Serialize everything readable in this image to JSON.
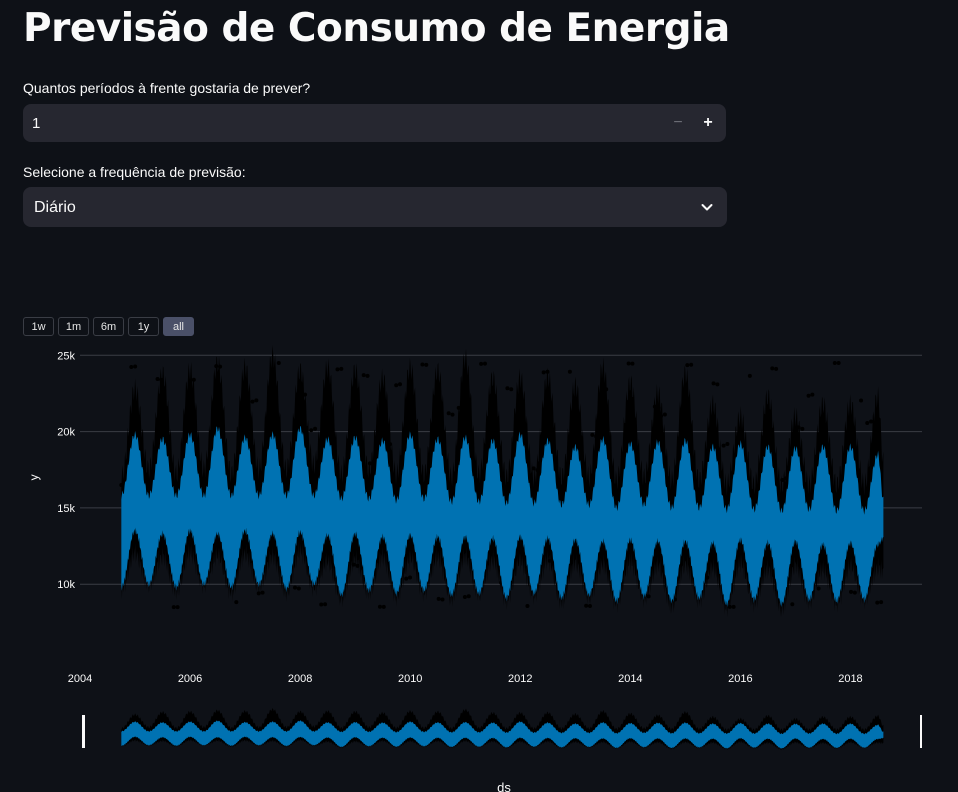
{
  "page_title": "Previsão de Consumo de Energia",
  "periods": {
    "label": "Quantos períodos à frente gostaria de prever?",
    "value": "1",
    "minus": "−",
    "plus": "+"
  },
  "frequency": {
    "label": "Selecione a frequência de previsão:",
    "value": "Diário"
  },
  "range_selector": {
    "buttons": [
      "1w",
      "1m",
      "6m",
      "1y",
      "all"
    ],
    "active": "all"
  },
  "colors": {
    "background": "#0e1117",
    "forecast": "#0072b2",
    "actual": "#000000",
    "grid": "#3a3d45"
  },
  "chart_data": {
    "type": "line",
    "xlabel": "ds",
    "ylabel": "y",
    "xlim": [
      2004,
      2019.3
    ],
    "ylim": [
      7000,
      26000
    ],
    "x_ticks": [
      "2004",
      "2006",
      "2008",
      "2010",
      "2012",
      "2014",
      "2016",
      "2018"
    ],
    "y_ticks": [
      {
        "value": 10000,
        "label": "10k"
      },
      {
        "value": 15000,
        "label": "15k"
      },
      {
        "value": 20000,
        "label": "20k"
      },
      {
        "value": 25000,
        "label": "25k"
      }
    ],
    "grid": true,
    "rangeslider": true,
    "series": [
      {
        "kind": "forecast band (yhat)",
        "x": [
          2004.75,
          2005.0,
          2005.25,
          2005.5,
          2005.75,
          2006.0,
          2006.25,
          2006.5,
          2006.75,
          2007.0,
          2007.25,
          2007.5,
          2007.75,
          2008.0,
          2008.25,
          2008.5,
          2008.75,
          2009.0,
          2009.25,
          2009.5,
          2009.75,
          2010.0,
          2010.25,
          2010.5,
          2010.75,
          2011.0,
          2011.25,
          2011.5,
          2011.75,
          2012.0,
          2012.25,
          2012.5,
          2012.75,
          2013.0,
          2013.25,
          2013.5,
          2013.75,
          2014.0,
          2014.25,
          2014.5,
          2014.75,
          2015.0,
          2015.25,
          2015.5,
          2015.75,
          2016.0,
          2016.25,
          2016.5,
          2016.75,
          2017.0,
          2017.25,
          2017.5,
          2017.75,
          2018.0,
          2018.25,
          2018.5,
          2018.6
        ],
        "upper": [
          15800,
          19800,
          15800,
          19500,
          15800,
          19800,
          15800,
          20200,
          15800,
          19600,
          15800,
          19800,
          15800,
          20200,
          15800,
          19500,
          15600,
          19600,
          15600,
          19400,
          15500,
          19800,
          15600,
          19500,
          15400,
          19600,
          15400,
          19400,
          15300,
          19800,
          15300,
          19400,
          15200,
          19000,
          15200,
          19500,
          15000,
          19200,
          15200,
          19300,
          15000,
          19400,
          15000,
          19000,
          14900,
          19200,
          14900,
          19000,
          14800,
          18900,
          14900,
          19000,
          14800,
          19000,
          14800,
          18500,
          15500
        ],
        "lower": [
          9800,
          13500,
          10000,
          13300,
          9800,
          13500,
          10000,
          13300,
          9800,
          13500,
          10000,
          13300,
          9700,
          13400,
          10000,
          13200,
          9300,
          13300,
          9600,
          13100,
          9400,
          13200,
          9600,
          13100,
          9300,
          13100,
          9400,
          13000,
          9100,
          13100,
          9400,
          13000,
          9100,
          12900,
          9300,
          12800,
          8900,
          12900,
          9200,
          12800,
          8900,
          12800,
          9100,
          12700,
          8700,
          12900,
          9000,
          12700,
          8700,
          12800,
          9000,
          12600,
          8900,
          12700,
          9000,
          12600,
          13000
        ]
      },
      {
        "kind": "observed (y)",
        "x": [
          2004.75,
          2005.0,
          2005.25,
          2005.5,
          2005.75,
          2006.0,
          2006.25,
          2006.5,
          2006.75,
          2007.0,
          2007.25,
          2007.5,
          2007.75,
          2008.0,
          2008.25,
          2008.5,
          2008.75,
          2009.0,
          2009.25,
          2009.5,
          2009.75,
          2010.0,
          2010.25,
          2010.5,
          2010.75,
          2011.0,
          2011.25,
          2011.5,
          2011.75,
          2012.0,
          2012.25,
          2012.5,
          2012.75,
          2013.0,
          2013.25,
          2013.5,
          2013.75,
          2014.0,
          2014.25,
          2014.5,
          2014.75,
          2015.0,
          2015.25,
          2015.5,
          2015.75,
          2016.0,
          2016.25,
          2016.5,
          2016.75,
          2017.0,
          2017.25,
          2017.5,
          2017.75,
          2018.0,
          2018.25,
          2018.5,
          2018.6
        ],
        "upper": [
          17000,
          22800,
          17500,
          23800,
          17200,
          24000,
          17500,
          24500,
          17200,
          24200,
          17500,
          25000,
          17500,
          24000,
          17800,
          24200,
          17200,
          24000,
          17500,
          23500,
          17200,
          24200,
          17200,
          24000,
          17000,
          24800,
          17200,
          23500,
          17000,
          23500,
          17000,
          23600,
          17000,
          23000,
          17000,
          24200,
          16800,
          23200,
          17000,
          22500,
          16800,
          23800,
          16800,
          21800,
          16500,
          21000,
          16500,
          22300,
          16500,
          21000,
          16500,
          21800,
          16500,
          21800,
          16500,
          22300,
          18000
        ],
        "lower": [
          9700,
          12000,
          10000,
          11800,
          9600,
          12100,
          10000,
          11900,
          9500,
          12000,
          9900,
          11800,
          9500,
          12200,
          9800,
          11500,
          9100,
          11600,
          9500,
          11800,
          9200,
          11700,
          9500,
          11800,
          9100,
          11800,
          9400,
          11600,
          9000,
          11500,
          9300,
          11600,
          8900,
          11400,
          9200,
          11300,
          8800,
          11500,
          9100,
          11200,
          8600,
          11300,
          9000,
          11100,
          8500,
          11400,
          8800,
          11000,
          8400,
          11200,
          8900,
          11000,
          8800,
          11200,
          9000,
          11100,
          10800
        ]
      }
    ]
  }
}
